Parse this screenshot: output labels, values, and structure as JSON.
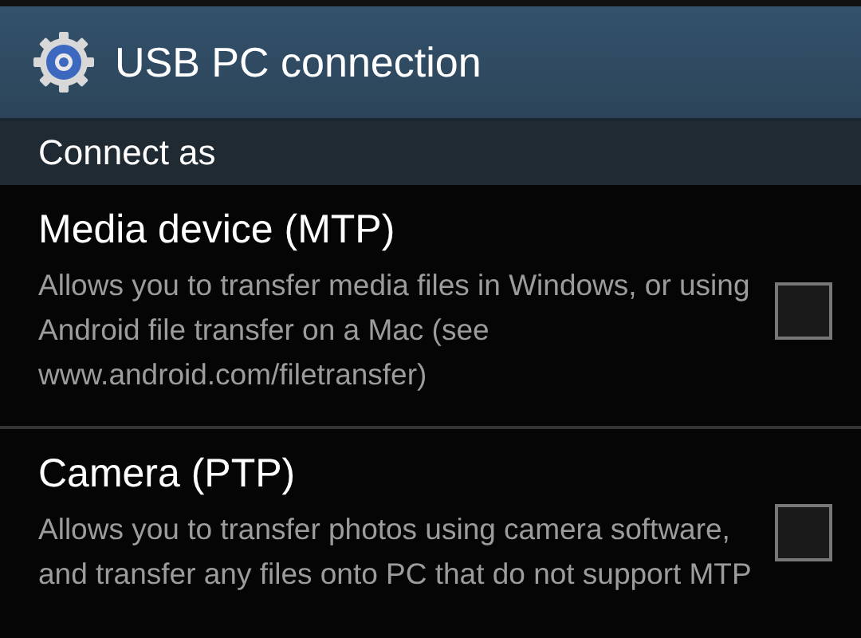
{
  "header": {
    "title": "USB PC connection"
  },
  "section": {
    "title": "Connect as"
  },
  "options": [
    {
      "title": "Media device (MTP)",
      "description": "Allows you to transfer media files in Windows, or using Android file transfer on a Mac (see www.android.com/filetransfer)",
      "checked": false
    },
    {
      "title": "Camera (PTP)",
      "description": "Allows you to transfer photos using camera software, and transfer any files onto PC that do not support MTP",
      "checked": false
    }
  ]
}
